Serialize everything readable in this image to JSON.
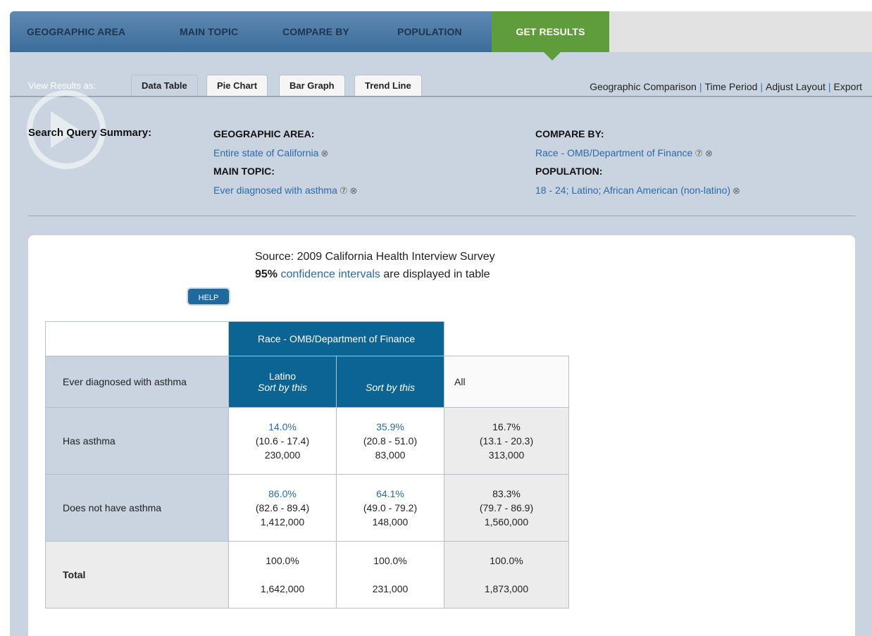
{
  "nav": {
    "items": [
      "GEOGRAPHIC AREA",
      "MAIN TOPIC",
      "COMPARE BY",
      "POPULATION"
    ],
    "active": "GET RESULTS"
  },
  "view": {
    "label": "View Results as:",
    "tabs": [
      "Data Table",
      "Pie Chart",
      "Bar Graph",
      "Trend Line"
    ]
  },
  "actions": [
    "Geographic Comparison",
    "Time Period",
    "Adjust Layout",
    "Export"
  ],
  "summary": {
    "title": "Search Query Summary:",
    "geo_label": "GEOGRAPHIC AREA:",
    "geo_value": "Entire state of California",
    "topic_label": "MAIN TOPIC:",
    "topic_value": "Ever diagnosed with asthma",
    "compare_label": "COMPARE BY:",
    "compare_value": "Race - OMB/Department of Finance",
    "pop_label": "POPULATION:",
    "pop_value": "18 - 24; Latino; African American (non-latino)"
  },
  "source": {
    "line1": "Source: 2009 California Health Interview Survey",
    "ci_bold": "95%",
    "ci_link": "confidence intervals",
    "ci_rest": "are displayed in table"
  },
  "help_label": "HELP",
  "table": {
    "group_header": "Race - OMB/Department of Finance",
    "question": "Ever diagnosed with asthma",
    "col1_name": "Latino",
    "sort_label": "Sort by this",
    "all_label": "All",
    "rows": [
      {
        "label": "Has asthma",
        "c1": {
          "pct": "14.0%",
          "ci": "(10.6 - 17.4)",
          "n": "230,000"
        },
        "c2": {
          "pct": "35.9%",
          "ci": "(20.8 - 51.0)",
          "n": "83,000"
        },
        "all": {
          "pct": "16.7%",
          "ci": "(13.1 - 20.3)",
          "n": "313,000"
        }
      },
      {
        "label": "Does not have asthma",
        "c1": {
          "pct": "86.0%",
          "ci": "(82.6 - 89.4)",
          "n": "1,412,000"
        },
        "c2": {
          "pct": "64.1%",
          "ci": "(49.0 - 79.2)",
          "n": "148,000"
        },
        "all": {
          "pct": "83.3%",
          "ci": "(79.7 - 86.9)",
          "n": "1,560,000"
        }
      }
    ],
    "total": {
      "label": "Total",
      "c1": {
        "pct": "100.0%",
        "n": "1,642,000"
      },
      "c2": {
        "pct": "100.0%",
        "n": "231,000"
      },
      "all": {
        "pct": "100.0%",
        "n": "1,873,000"
      }
    }
  },
  "colors": {
    "nav_blue": "#3d6c99",
    "active_green": "#5f9c3c",
    "header_blue": "#0c6494",
    "link": "#2a6aa8"
  },
  "icons": {
    "remove": "circled-x-icon",
    "help": "question-circle-icon"
  }
}
